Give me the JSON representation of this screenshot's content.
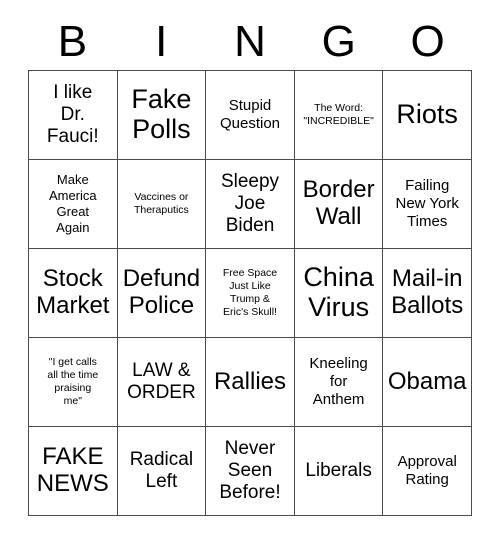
{
  "card": {
    "title": "BINGO",
    "header_letters": [
      "B",
      "I",
      "N",
      "G",
      "O"
    ],
    "colors": {
      "background": "#ffffff",
      "text": "#000000",
      "border": "#4a4a4a"
    },
    "grid_size": "5x5",
    "cells": [
      {
        "id": "b1",
        "text": "I like\nDr.\nFauci!",
        "size": "md"
      },
      {
        "id": "i1",
        "text": "Fake\nPolls",
        "size": "xl"
      },
      {
        "id": "n1",
        "text": "Stupid\nQuestion",
        "size": "sm"
      },
      {
        "id": "g1",
        "text": "The Word:\n\"INCREDIBLE\"",
        "size": "xxs"
      },
      {
        "id": "o1",
        "text": "Riots",
        "size": "xl"
      },
      {
        "id": "b2",
        "text": "Make\nAmerica\nGreat\nAgain",
        "size": "xs"
      },
      {
        "id": "i2",
        "text": "Vaccines or\nTheraputics",
        "size": "xxs"
      },
      {
        "id": "n2",
        "text": "Sleepy\nJoe\nBiden",
        "size": "md"
      },
      {
        "id": "g2",
        "text": "Border\nWall",
        "size": "lg"
      },
      {
        "id": "o2",
        "text": "Failing\nNew York\nTimes",
        "size": "sm"
      },
      {
        "id": "b3",
        "text": "Stock\nMarket",
        "size": "lg"
      },
      {
        "id": "i3",
        "text": "Defund\nPolice",
        "size": "lg"
      },
      {
        "id": "n3",
        "text": "Free Space\nJust Like\nTrump &\nEric's Skull!",
        "size": "xxs"
      },
      {
        "id": "g3",
        "text": "China\nVirus",
        "size": "xl"
      },
      {
        "id": "o3",
        "text": "Mail-in\nBallots",
        "size": "lg"
      },
      {
        "id": "b4",
        "text": "\"I get calls\nall the time\npraising\nme\"",
        "size": "xxs"
      },
      {
        "id": "i4",
        "text": "LAW &\nORDER",
        "size": "md"
      },
      {
        "id": "n4",
        "text": "Rallies",
        "size": "lg"
      },
      {
        "id": "g4",
        "text": "Kneeling\nfor\nAnthem",
        "size": "sm"
      },
      {
        "id": "o4",
        "text": "Obama",
        "size": "lg"
      },
      {
        "id": "b5",
        "text": "FAKE\nNEWS",
        "size": "lg"
      },
      {
        "id": "i5",
        "text": "Radical\nLeft",
        "size": "md"
      },
      {
        "id": "n5",
        "text": "Never\nSeen\nBefore!",
        "size": "md"
      },
      {
        "id": "g5",
        "text": "Liberals",
        "size": "md"
      },
      {
        "id": "o5",
        "text": "Approval\nRating",
        "size": "sm"
      }
    ]
  }
}
